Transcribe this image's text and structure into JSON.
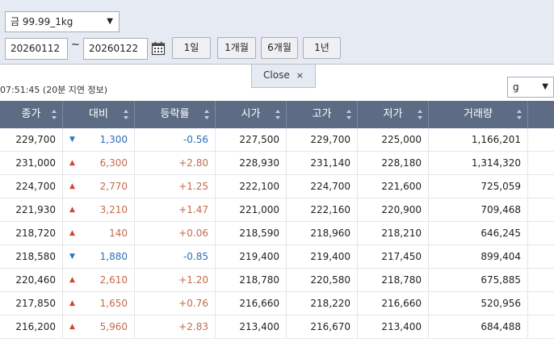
{
  "filter": {
    "product": "금 99.99_1kg",
    "start_date": "20260112",
    "tilde": "~",
    "end_date": "20260122",
    "periods": [
      "1일",
      "1개월",
      "6개월",
      "1년"
    ]
  },
  "close_tab": {
    "label": "Close",
    "x": "×"
  },
  "time_note": "07:51:45 (20분 지연 정보)",
  "unit": "g",
  "table": {
    "headers": [
      "종가",
      "대비",
      "등락률",
      "시가",
      "고가",
      "저가",
      "거래량"
    ],
    "rows": [
      {
        "close": "229,700",
        "dir": "down",
        "change": "1,300",
        "rate": "-0.56",
        "open": "227,500",
        "high": "229,700",
        "low": "225,000",
        "volume": "1,166,201"
      },
      {
        "close": "231,000",
        "dir": "up",
        "change": "6,300",
        "rate": "+2.80",
        "open": "228,930",
        "high": "231,140",
        "low": "228,180",
        "volume": "1,314,320"
      },
      {
        "close": "224,700",
        "dir": "up",
        "change": "2,770",
        "rate": "+1.25",
        "open": "222,100",
        "high": "224,700",
        "low": "221,600",
        "volume": "725,059"
      },
      {
        "close": "221,930",
        "dir": "up",
        "change": "3,210",
        "rate": "+1.47",
        "open": "221,000",
        "high": "222,160",
        "low": "220,900",
        "volume": "709,468"
      },
      {
        "close": "218,720",
        "dir": "up",
        "change": "140",
        "rate": "+0.06",
        "open": "218,590",
        "high": "218,960",
        "low": "218,210",
        "volume": "646,245"
      },
      {
        "close": "218,580",
        "dir": "down",
        "change": "1,880",
        "rate": "-0.85",
        "open": "219,400",
        "high": "219,400",
        "low": "217,450",
        "volume": "899,404"
      },
      {
        "close": "220,460",
        "dir": "up",
        "change": "2,610",
        "rate": "+1.20",
        "open": "218,780",
        "high": "220,580",
        "low": "218,780",
        "volume": "675,885"
      },
      {
        "close": "217,850",
        "dir": "up",
        "change": "1,650",
        "rate": "+0.76",
        "open": "216,660",
        "high": "218,220",
        "low": "216,660",
        "volume": "520,956"
      },
      {
        "close": "216,200",
        "dir": "up",
        "change": "5,960",
        "rate": "+2.83",
        "open": "213,400",
        "high": "216,670",
        "low": "213,400",
        "volume": "684,488"
      }
    ]
  },
  "colors": {
    "header_bg": "#5d6c84",
    "up": "#d2452b",
    "down": "#1f78c8"
  }
}
